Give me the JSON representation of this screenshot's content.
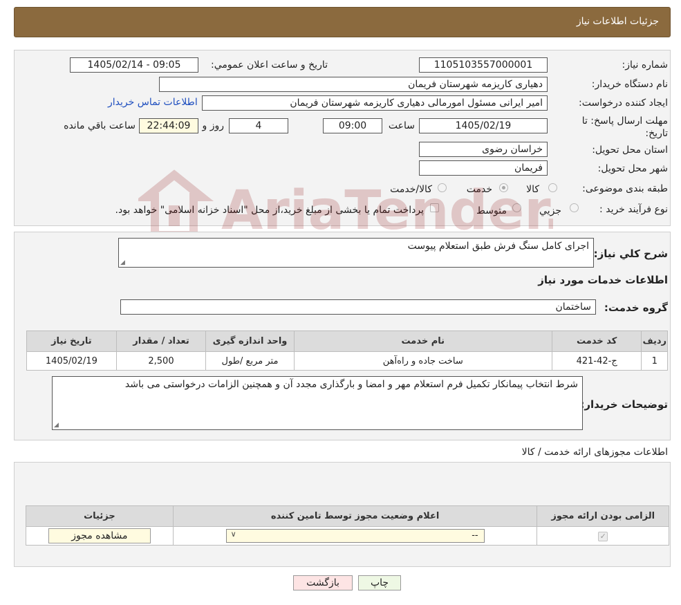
{
  "header": {
    "title": "جزئیات اطلاعات نیاز"
  },
  "form": {
    "need_number": {
      "label": "شماره نیاز:",
      "value": "1105103557000001"
    },
    "announce_datetime": {
      "label": "تاریخ و ساعت اعلان عمومي:",
      "value": "1405/02/14 - 09:05"
    },
    "buyer_org": {
      "label": "نام دستگاه خریدار:",
      "value": "دهیاری کاریزمه شهرستان فریمان"
    },
    "requester": {
      "label": "ایجاد کننده درخواست:",
      "value": "امیر ایرانی مسئول امورمالی دهیاری کاریزمه شهرستان فریمان",
      "contact_link": "اطلاعات تماس خریدار"
    },
    "deadline": {
      "label_line1": "مهلت ارسال پاسخ: تا",
      "label_line2": "تاریخ:",
      "date": "1405/02/19",
      "time_label": "ساعت",
      "time": "09:00",
      "days": "4",
      "days_label": "روز و",
      "remaining": "22:44:09",
      "remaining_label": "ساعت باقي مانده"
    },
    "province": {
      "label": "استان محل تحویل:",
      "value": "خراسان رضوی"
    },
    "city": {
      "label": "شهر محل تحویل:",
      "value": "فریمان"
    },
    "category": {
      "label": "طبقه بندی موضوعی:",
      "options": [
        "کالا",
        "خدمت",
        "کالا/خدمت"
      ],
      "selected": "خدمت"
    },
    "purchase_type": {
      "label": "نوع فرآیند خرید :",
      "options": [
        "جزیي",
        "متوسط"
      ],
      "note": "پرداخت تمام یا بخشی از مبلغ خرید،از محل \"اسناد خزانه اسلامی\" خواهد بود."
    }
  },
  "summary": {
    "label": "شرح کلي نیاز:",
    "value": "اجرای کامل سنگ فرش طبق استعلام پیوست"
  },
  "services": {
    "section_title": "اطلاعات خدمات مورد نیاز",
    "group_label": "گروه خدمت:",
    "group_value": "ساختمان",
    "columns": [
      "ردیف",
      "کد خدمت",
      "نام خدمت",
      "واحد اندازه گیری",
      "تعداد / مقدار",
      "تاریخ نیاز"
    ],
    "rows": [
      {
        "index": "1",
        "code": "ج-42-421",
        "name": "ساخت جاده و راه‌آهن",
        "unit": "متر مربع /طول",
        "qty": "2,500",
        "date": "1405/02/19"
      }
    ]
  },
  "buyer_notes": {
    "label": "توضیحات خریدار:",
    "value": "شرط انتخاب پیمانکار تکمیل فرم استعلام مهر و امضا و بارگذاری مجدد آن و همچنین الزامات درخواستی می باشد"
  },
  "permits": {
    "section_title": "اطلاعات مجوزهای ارائه خدمت / کالا",
    "columns": [
      "الزامی بودن ارائه مجوز",
      "اعلام وضعیت مجوز توسط تامین کننده",
      "جزئیات"
    ],
    "select_value": "--",
    "view_button": "مشاهده مجوز"
  },
  "actions": {
    "print": "چاپ",
    "back": "بازگشت"
  },
  "watermark": {
    "text": "AriaTender.neT"
  },
  "colors": {
    "header": "#8b6a3e",
    "panel": "#f3f3f3",
    "link": "#1f4fbf",
    "back_button": "#fde4e4",
    "print_button": "#eef8e4"
  }
}
